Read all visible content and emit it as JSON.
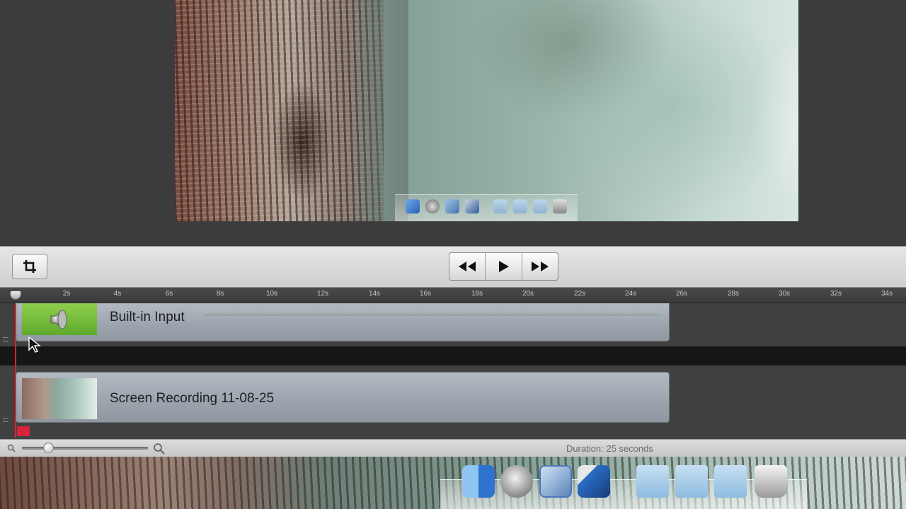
{
  "toolbar": {
    "crop_icon": "crop-icon",
    "rewind_icon": "rewind-icon",
    "play_icon": "play-icon",
    "fast_forward_icon": "fast-forward-icon"
  },
  "ruler": {
    "ticks": [
      "2s",
      "4s",
      "6s",
      "8s",
      "10s",
      "12s",
      "14s",
      "16s",
      "18s",
      "20s",
      "22s",
      "24s",
      "26s",
      "28s",
      "30s",
      "32s",
      "34s"
    ]
  },
  "tracks": {
    "audio": {
      "label": "Built-in Input",
      "icon": "speaker-icon"
    },
    "video": {
      "label": "Screen Recording 11-08-25"
    }
  },
  "status": {
    "duration": "Duration: 25 seconds",
    "zoom_out_icon": "zoom-out-icon",
    "zoom_in_icon": "zoom-in-icon",
    "zoom_level": 0.2
  },
  "colors": {
    "playhead": "#d8233a",
    "audio_clip_accent": "#7cc23c"
  }
}
